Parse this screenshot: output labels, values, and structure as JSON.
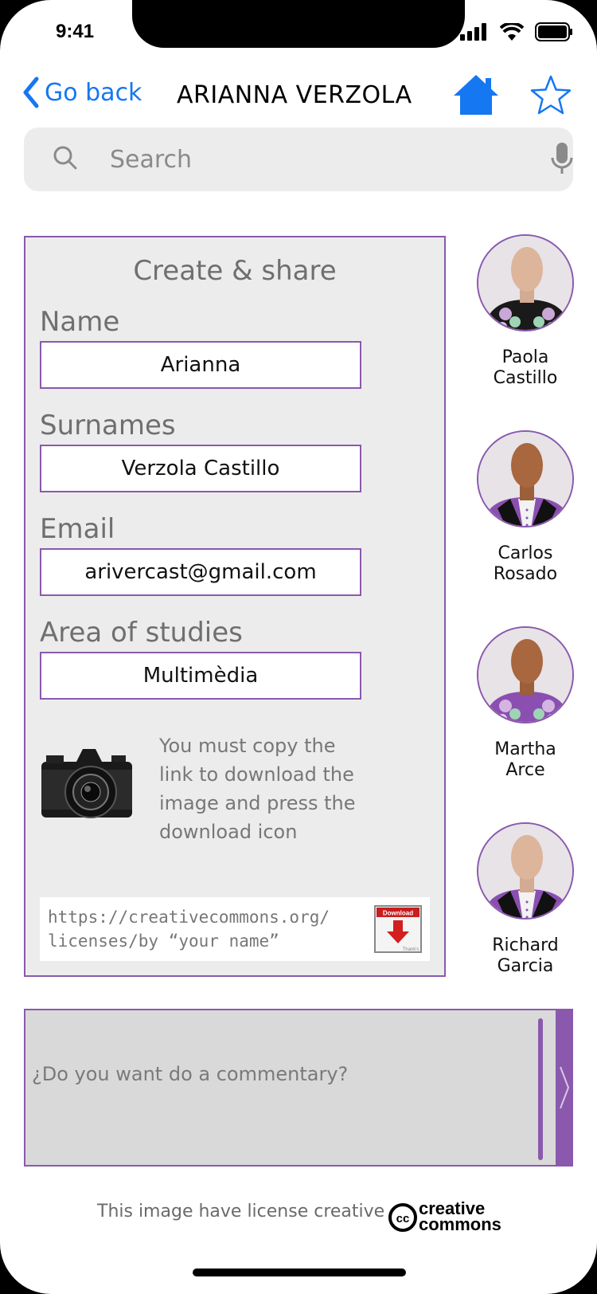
{
  "status_bar": {
    "time": "9:41"
  },
  "nav": {
    "back_label": "Go back",
    "title": "ARIANNA VERZOLA",
    "home_icon": "home-icon",
    "star_icon": "star-icon"
  },
  "search": {
    "placeholder": "Search"
  },
  "form": {
    "title": "Create & share",
    "fields": [
      {
        "label": "Name",
        "value": "Arianna"
      },
      {
        "label": "Surnames",
        "value": "Verzola Castillo"
      },
      {
        "label": "Email",
        "value": "arivercast@gmail.com"
      },
      {
        "label": "Area of studies",
        "value": "Multimèdia"
      }
    ],
    "note": "You must copy the link to download the image and press the download icon",
    "link": "https://creativecommons.org/ licenses/by “your name”",
    "download_icon_label": "Download",
    "download_icon_sub": "Thank's"
  },
  "people": [
    {
      "name_line1": "Paola",
      "name_line2": "Castillo"
    },
    {
      "name_line1": "Carlos",
      "name_line2": "Rosado"
    },
    {
      "name_line1": "Martha",
      "name_line2": "Arce"
    },
    {
      "name_line1": "Richard",
      "name_line2": "Garcia"
    }
  ],
  "comment": {
    "placeholder": "¿Do you want do a commentary?"
  },
  "footer": {
    "license_text": "This image have license creative",
    "cc_line1": "creative",
    "cc_line2": "commons"
  },
  "colors": {
    "accent": "#8a59ad",
    "link_blue": "#1577f2"
  }
}
